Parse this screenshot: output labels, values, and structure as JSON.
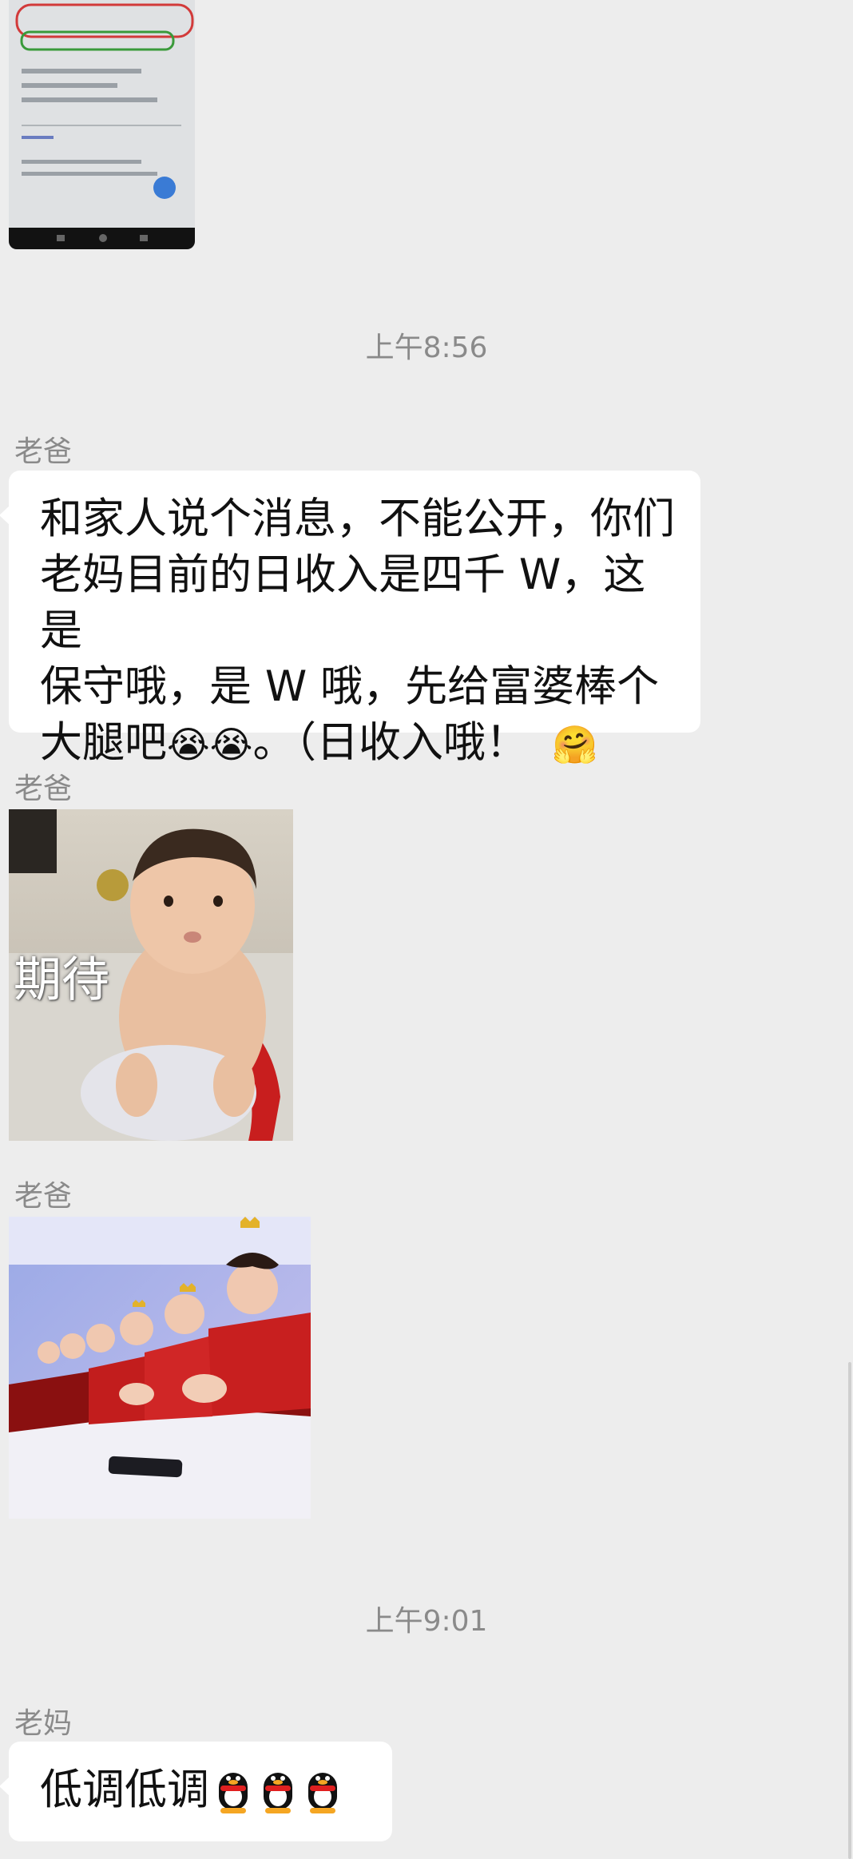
{
  "chat": {
    "timestamps": [
      "上午8:56",
      "上午9:01"
    ],
    "messages": [
      {
        "sender": "老爸",
        "text_lines": [
          "和家人说个消息，不能公开，你们",
          "老妈目前的日收入是四千 W，这是",
          "保守哦，是 W 哦，先给富婆棒个",
          "大腿吧"
        ],
        "text_tail": "。（日收入哦！",
        "emoji_names": [
          "laugh-cry-emoji",
          "laugh-cry-emoji",
          "hug-emoji"
        ],
        "emoji_glyphs": [
          "😭",
          "😭",
          "🤗"
        ]
      },
      {
        "sender": "老爸",
        "sticker_caption": "期待"
      },
      {
        "sender": "老爸"
      },
      {
        "sender": "老妈",
        "text": "低调低调",
        "emoji_names": [
          "qq-penguin-emoji",
          "qq-penguin-emoji",
          "qq-penguin-emoji"
        ]
      }
    ]
  },
  "colors": {
    "background": "#ededed",
    "bubble": "#ffffff",
    "meta_text": "#8a8a8a"
  }
}
